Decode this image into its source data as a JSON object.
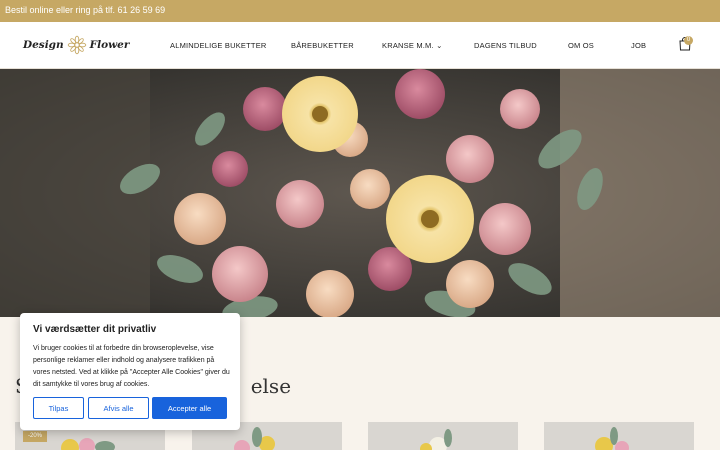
{
  "topbar": {
    "text": "Bestil online eller ring på tlf. 61 26 59 69"
  },
  "logo": {
    "left": "Design",
    "right": "Flower"
  },
  "nav": [
    {
      "label": "ALMINDELIGE BUKETTER"
    },
    {
      "label": "BÅREBUKETTER"
    },
    {
      "label": "KRANSE M.M. ⌄"
    },
    {
      "label": "DAGENS TILBUD"
    },
    {
      "label": "OM OS"
    },
    {
      "label": "JOB"
    }
  ],
  "cart": {
    "count": "0",
    "icon": "shopping-bag-icon"
  },
  "section": {
    "title_start": "S",
    "title_end": "else"
  },
  "products": [
    {
      "badge": "-20%"
    },
    {
      "badge": ""
    },
    {
      "badge": ""
    },
    {
      "badge": ""
    }
  ],
  "cookie": {
    "title": "Vi værdsætter dit privatliv",
    "text": "Vi bruger cookies til at forbedre din browseroplevelse, vise personlige reklamer eller indhold og analysere trafikken på vores netsted. Ved at klikke på \"Accepter Alle Cookies\" giver du dit samtykke til vores brug af cookies.",
    "customize": "Tilpas",
    "reject": "Afvis alle",
    "accept": "Accepter alle"
  },
  "colors": {
    "brand_gold": "#c6a864",
    "button_blue": "#1863dc"
  }
}
